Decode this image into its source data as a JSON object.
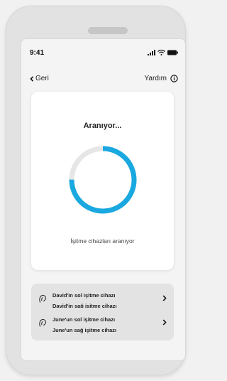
{
  "status": {
    "time": "9:41"
  },
  "nav": {
    "back_label": "Geri",
    "help_label": "Yardım"
  },
  "search": {
    "title": "Aranıyor...",
    "subtitle": "İşitme cihazları aranıyor",
    "progress": 0.75,
    "accent_color": "#1aa8e0",
    "track_color": "#e6e6e6"
  },
  "devices": [
    {
      "left_label": "David'in sol işitme cihazı",
      "right_label": "David'in sağ işitme cihazı"
    },
    {
      "left_label": "June'un sol işitme cihazı",
      "right_label": "June'un sağ işitme cihazı"
    }
  ],
  "icons": {
    "back": "chevron-left-icon",
    "help": "info-circle-icon",
    "hearing_aid": "hearing-aid-icon",
    "row_arrow": "chevron-right-icon"
  }
}
